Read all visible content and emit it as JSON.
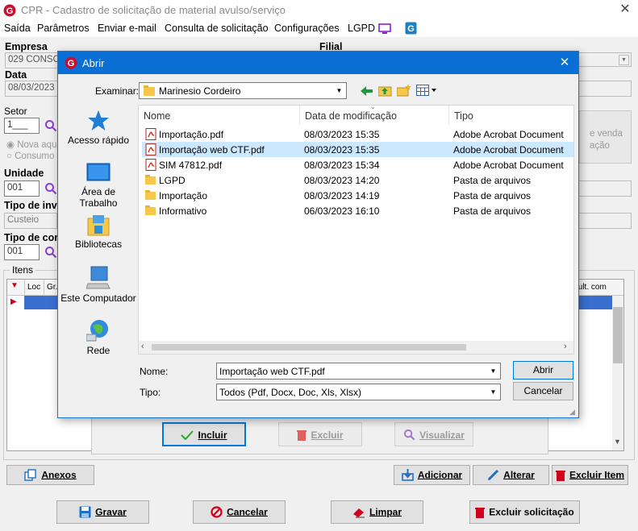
{
  "window": {
    "title": "CPR - Cadastro de solicitação de material avulso/serviço",
    "close_glyph": "✕"
  },
  "menu": {
    "items": [
      "Saída",
      "Parâmetros",
      "Enviar e-mail",
      "Consulta de solicitação",
      "Configurações",
      "LGPD"
    ]
  },
  "form": {
    "empresa_label": "Empresa",
    "empresa_value": "029 CONSOR",
    "filial_label": "Filial",
    "data_label": "Data",
    "data_value": "08/03/2023",
    "setor_label": "Setor",
    "setor_value": "1___",
    "radio_nova": "Nova aqu",
    "radio_consumo": "Consumo",
    "right_box_line1": "e venda",
    "right_box_line2": "ação",
    "unidade_label": "Unidade",
    "unidade_value": "001",
    "tipo_inv_label": "Tipo de inve",
    "tipo_inv_value": "Custeio",
    "tipo_com_label": "Tipo de com",
    "tipo_com_value": "001",
    "itens_label": "Itens",
    "grid_col_loc": "Loc",
    "grid_col_gr": "Gr.",
    "grid_col_right": "l. ult. com"
  },
  "sub_buttons": {
    "incluir": "Incluir",
    "excluir": "Excluir",
    "visualizar": "Visualizar"
  },
  "item_buttons": {
    "anexos": "Anexos",
    "adicionar": "Adicionar",
    "alterar": "Alterar",
    "excluir_item": "Excluir Item"
  },
  "footer_buttons": {
    "gravar": "Gravar",
    "cancelar": "Cancelar",
    "limpar": "Limpar",
    "excluir_solicitacao": "Excluir solicitação"
  },
  "dialog": {
    "title": "Abrir",
    "close_glyph": "✕",
    "examinar_label": "Examinar:",
    "current_folder": "Marinesio Cordeiro",
    "places": [
      "Acesso rápido",
      "Área de Trabalho",
      "Bibliotecas",
      "Este Computador",
      "Rede"
    ],
    "columns": [
      "Nome",
      "Data de modificação",
      "Tipo"
    ],
    "files": [
      {
        "name": "Importação.pdf",
        "date": "08/03/2023 15:35",
        "type": "Adobe Acrobat Document",
        "kind": "pdf"
      },
      {
        "name": "Importação web CTF.pdf",
        "date": "08/03/2023 15:35",
        "type": "Adobe Acrobat Document",
        "kind": "pdf"
      },
      {
        "name": "SIM 47812.pdf",
        "date": "08/03/2023 15:34",
        "type": "Adobe Acrobat Document",
        "kind": "pdf"
      },
      {
        "name": "LGPD",
        "date": "08/03/2023 14:20",
        "type": "Pasta de arquivos",
        "kind": "folder"
      },
      {
        "name": "Importação",
        "date": "08/03/2023 14:19",
        "type": "Pasta de arquivos",
        "kind": "folder"
      },
      {
        "name": "Informativo",
        "date": "06/03/2023 16:10",
        "type": "Pasta de arquivos",
        "kind": "folder"
      }
    ],
    "selected_index": 1,
    "nome_label": "Nome:",
    "nome_value": "Importação web CTF.pdf",
    "tipo_label": "Tipo:",
    "tipo_value": "Todos (Pdf, Docx, Doc, Xls, Xlsx)",
    "abrir_button": "Abrir",
    "cancelar_button": "Cancelar"
  },
  "colors": {
    "dialog_title_bg": "#0a6fd5",
    "selection": "#cce8ff",
    "accent_blue": "#0078d7",
    "delete_red": "#d0021b"
  }
}
